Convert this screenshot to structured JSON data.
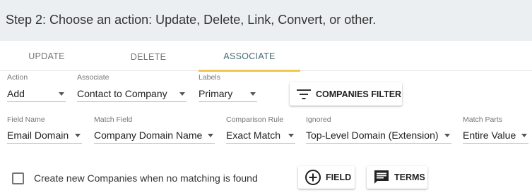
{
  "header": {
    "title": "Step 2: Choose an action: Update, Delete, Link, Convert, or other."
  },
  "tabs": [
    {
      "label": "UPDATE",
      "active": false
    },
    {
      "label": "DELETE",
      "active": false
    },
    {
      "label": "ASSOCIATE",
      "active": true
    }
  ],
  "row1": {
    "action": {
      "label": "Action",
      "value": "Add"
    },
    "associate": {
      "label": "Associate",
      "value": "Contact to Company"
    },
    "labels": {
      "label": "Labels",
      "value": "Primary"
    },
    "filter_button": {
      "label": "COMPANIES FILTER",
      "icon": "filter-icon"
    }
  },
  "row2": {
    "field_name": {
      "label": "Field Name",
      "value": "Email Domain"
    },
    "match_field": {
      "label": "Match Field",
      "value": "Company Domain Name"
    },
    "comparison_rule": {
      "label": "Comparison Rule",
      "value": "Exact Match"
    },
    "ignored": {
      "label": "Ignored",
      "value": "Top-Level Domain (Extension)"
    },
    "match_parts": {
      "label": "Match Parts",
      "value": "Entire Value"
    }
  },
  "footer": {
    "create_checkbox": {
      "label": "Create new Companies when no matching is found",
      "checked": false
    },
    "field_button": {
      "label": "FIELD",
      "icon": "add-circle-icon"
    },
    "terms_button": {
      "label": "TERMS",
      "icon": "message-icon"
    }
  },
  "colors": {
    "header_bg": "#eceff1",
    "active_tab_indicator": "#f2c94c",
    "active_tab_text": "#4a6b75"
  }
}
